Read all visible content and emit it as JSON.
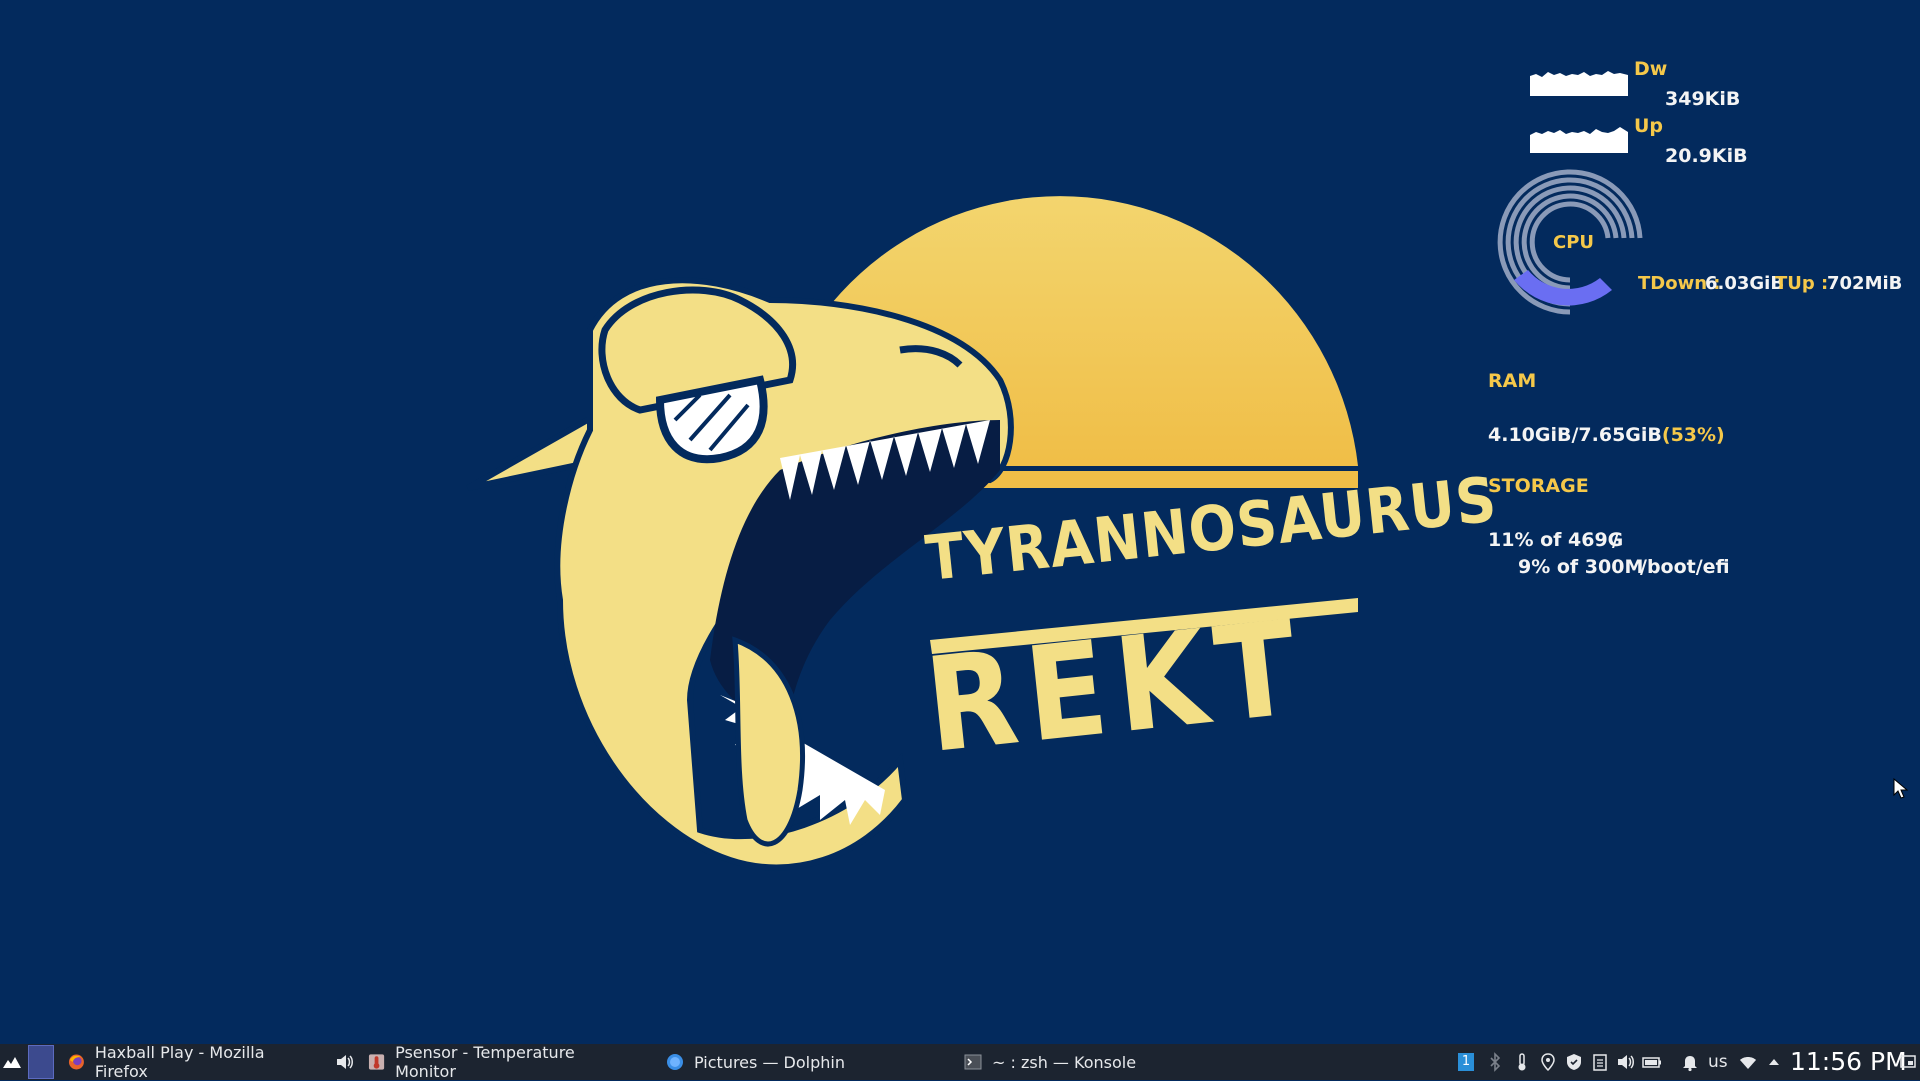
{
  "wallpaper": {
    "title_line1": "TYRANNOSAURUS",
    "title_line2": "REKT",
    "colors": {
      "background": "#032a5d",
      "sun": "#f2c95c",
      "dino": "#f3df86"
    }
  },
  "conky": {
    "down_label": "Dw",
    "down_value": "349KiB",
    "up_label": "Up",
    "up_value": "20.9KiB",
    "cpu_label": "CPU",
    "total_down_label": "TDown :",
    "total_down_value": "6.03GiB",
    "total_up_label": "TUp :",
    "total_up_value": "702MiB",
    "ram_label": "RAM",
    "ram_used": "4.10GiB",
    "ram_total": "7.65GiB",
    "ram_separator": "/",
    "ram_percent": "(53%)",
    "storage_label": "STORAGE",
    "storage": [
      {
        "usage": "11% of 469G",
        "mount": "/"
      },
      {
        "usage": "9% of 300M",
        "mount": "/boot/efi"
      }
    ],
    "cpu_level": 0.12,
    "colors": {
      "label": "#f5c84a",
      "value": "#f4f4f4",
      "ring": "#8a9ab8",
      "cpu_fill": "#6a6ef2"
    }
  },
  "taskbar": {
    "tasks": [
      {
        "label": "Haxball Play - Mozilla Firefox",
        "icon": "firefox-icon"
      },
      {
        "label": "Psensor - Temperature Monitor",
        "icon": "psensor-icon"
      },
      {
        "label": "Pictures — Dolphin",
        "icon": "dolphin-icon"
      },
      {
        "label": "~ : zsh — Konsole",
        "icon": "konsole-icon"
      }
    ],
    "pager_badge": "1",
    "keyboard_layout": "us",
    "clock": "11:56 PM"
  }
}
